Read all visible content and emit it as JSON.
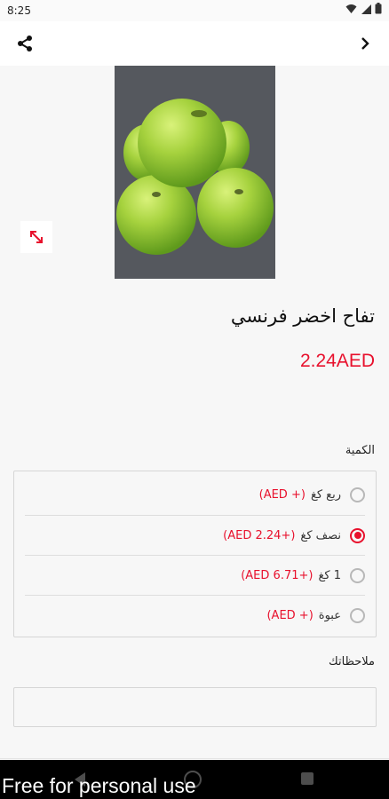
{
  "status_bar": {
    "time": "8:25",
    "icons": [
      "wifi-icon",
      "signal-icon",
      "battery-icon"
    ]
  },
  "app_bar": {
    "icons": [
      "share-icon",
      "chevron-right-icon"
    ]
  },
  "product": {
    "image_alt": "green-apples-photo",
    "title": "تفاح اخضر فرنسي",
    "price": "2.24AED"
  },
  "quantity": {
    "label": "الكمية",
    "options": [
      {
        "name": "ربع كغ",
        "delta": "(+ AED)",
        "selected": false
      },
      {
        "name": "نصف كغ",
        "delta": "(+2.24 AED)",
        "selected": true
      },
      {
        "name": "1 كغ",
        "delta": "(+6.71 AED)",
        "selected": false
      },
      {
        "name": "عبوة",
        "delta": "(+ AED)",
        "selected": false
      }
    ]
  },
  "notes": {
    "label": "ملاحظاتك",
    "value": ""
  },
  "watermark": "Free for personal use",
  "colors": {
    "accent": "#e8112d",
    "image_bg": "#55585e",
    "apple": "#9fce3a"
  }
}
